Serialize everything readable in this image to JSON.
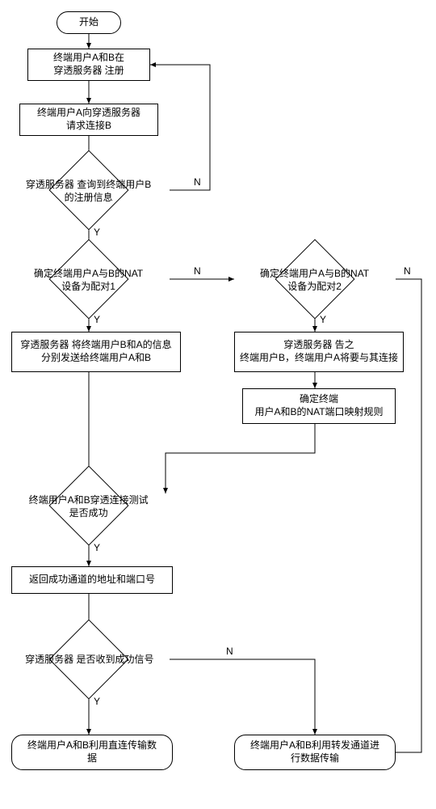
{
  "flowchart": {
    "type": "nat-traversal-flow",
    "language": "zh-CN",
    "nodes": {
      "start": "开始",
      "register": "终端用户A和B在\n穿透服务器 注册",
      "requestConnect": "终端用户A向穿透服务器\n请求连接B",
      "queryB": "穿透服务器 查询到终端用户B\n的注册信息",
      "pair1": "确定终端用户A与B的NAT\n设备为配对1",
      "pair2": "确定终端用户A与B的NAT\n设备为配对2",
      "sendInfo": "穿透服务器 将终端用户B和A的信息\n分别发送给终端用户A和B",
      "notifyB": "穿透服务器 告之\n终端用户B，终端用户A将要与其连接",
      "mapRule": "确定终端\n用户A和B的NAT端口映射规则",
      "testSuccess": "终端用户A和B穿透连接测试\n是否成功",
      "returnAddr": "返回成功通道的地址和端口号",
      "recvSignal": "穿透服务器 是否收到成功信号",
      "directTransfer": "终端用户A和B利用直连传输数\n据",
      "relayTransfer": "终端用户A和B利用转发通道进\n行数据传输"
    },
    "labels": {
      "yes": "Y",
      "no": "N"
    }
  }
}
